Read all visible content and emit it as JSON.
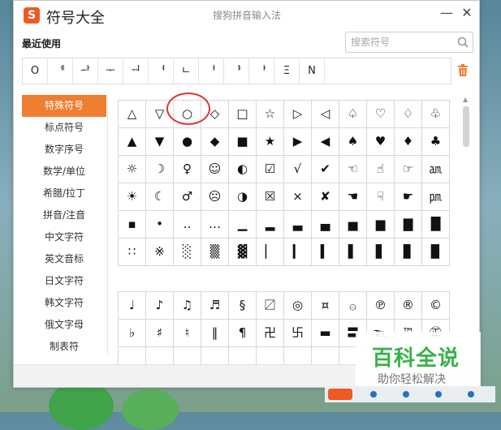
{
  "window": {
    "logo_glyph": "S",
    "title": "符号大全",
    "subtitle": "搜狗拼音输入法",
    "minimize_label": "—",
    "close_label": "✕"
  },
  "recent": {
    "label": "最近使用",
    "items": [
      "O",
      "ᅦ",
      "ᅪ",
      "ᅮ",
      "ᅯ",
      "ᅧ",
      "ㄴ",
      "ᅥ",
      "ᅣ",
      "ᅡ",
      "Ξ",
      "N"
    ]
  },
  "search": {
    "placeholder": "搜索符号"
  },
  "sidebar": {
    "items": [
      {
        "label": "特殊符号",
        "active": true
      },
      {
        "label": "标点符号"
      },
      {
        "label": "数字序号"
      },
      {
        "label": "数学/单位"
      },
      {
        "label": "希腊/拉丁"
      },
      {
        "label": "拼音/注音"
      },
      {
        "label": "中文字符"
      },
      {
        "label": "英文音标"
      },
      {
        "label": "日文字符"
      },
      {
        "label": "韩文字符"
      },
      {
        "label": "俄文字母"
      },
      {
        "label": "制表符"
      }
    ]
  },
  "grid1": {
    "rows": [
      [
        "△",
        "▽",
        "○",
        "◇",
        "□",
        "☆",
        "▷",
        "◁",
        "♤",
        "♡",
        "♢",
        "♧"
      ],
      [
        "▲",
        "▼",
        "●",
        "◆",
        "■",
        "★",
        "▶",
        "◀",
        "♠",
        "♥",
        "♦",
        "♣"
      ],
      [
        "☼",
        "☽",
        "♀",
        "☺",
        "◐",
        "☑",
        "√",
        "✔",
        "☜",
        "☝",
        "☞",
        "㏂"
      ],
      [
        "☀",
        "☾",
        "♂",
        "☹",
        "◑",
        "☒",
        "×",
        "✘",
        "☚",
        "☟",
        "☛",
        "㏘"
      ],
      [
        "▪",
        "•",
        "‥",
        "…",
        "▁",
        "▂",
        "▃",
        "▄",
        "▅",
        "▆",
        "▇",
        "█"
      ],
      [
        "∷",
        "※",
        "░",
        "▒",
        "▓",
        "▏",
        "▎",
        "▍",
        "▌",
        "▋",
        "▊",
        "▉"
      ]
    ]
  },
  "grid2": {
    "rows": [
      [
        "♩",
        "♪",
        "♫",
        "♬",
        "§",
        "〼",
        "◎",
        "¤",
        "۞",
        "℗",
        "®",
        "©"
      ],
      [
        "♭",
        "♯",
        "♮",
        "‖",
        "¶",
        "卍",
        "卐",
        "▬",
        "〓",
        "℡",
        "™",
        "㊣"
      ],
      [
        "",
        "",
        "",
        "",
        "",
        "",
        "",
        "",
        "",
        "",
        "",
        ""
      ]
    ]
  },
  "watermark": {
    "title": "百科全说",
    "subtitle": "助你轻松解决"
  },
  "colors": {
    "accent": "#f07e30",
    "highlight_ring": "#e0303a",
    "watermark_green": "#38b24a"
  }
}
